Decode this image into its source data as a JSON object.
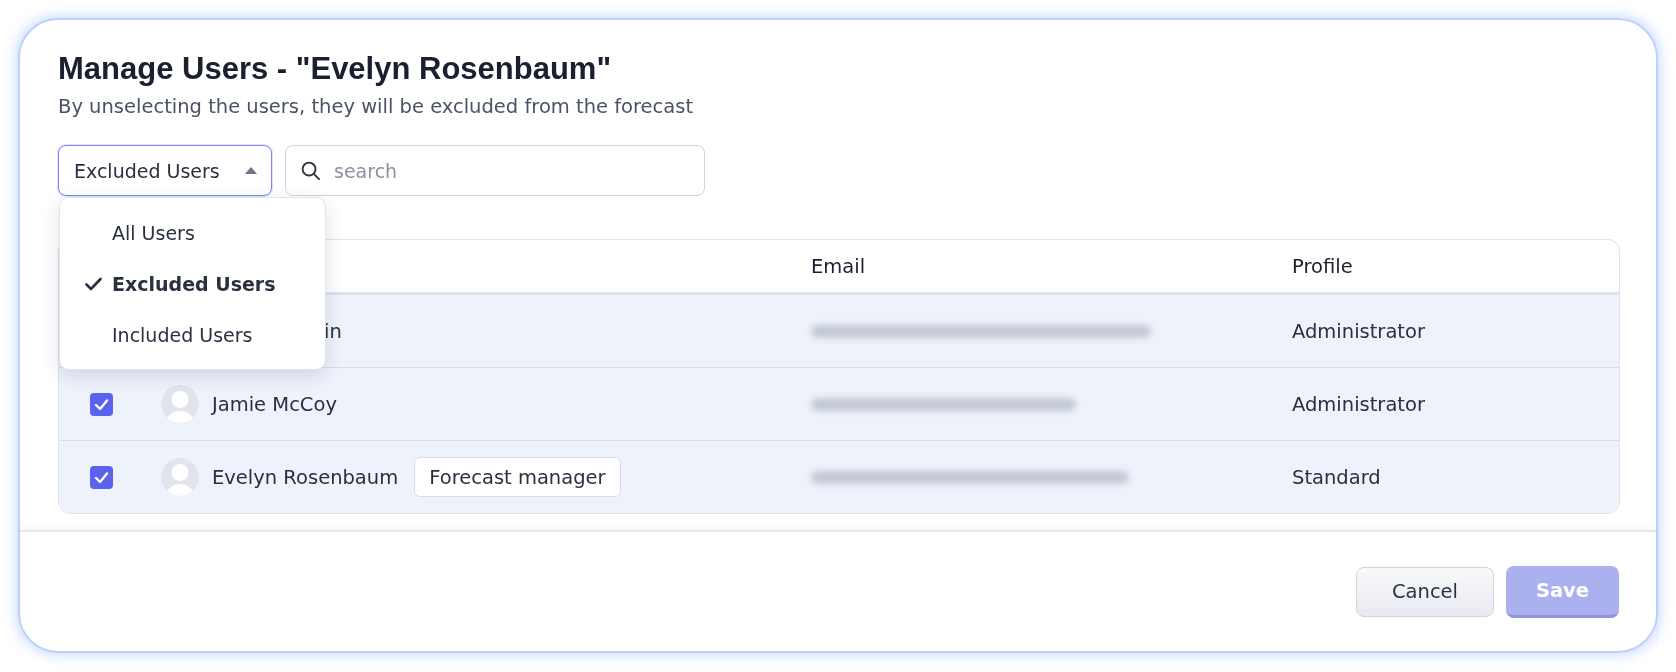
{
  "dialog": {
    "title": "Manage Users - \"Evelyn Rosenbaum\"",
    "subtitle": "By unselecting the users, they will be excluded from the forecast"
  },
  "filter": {
    "value": "Excluded Users",
    "expanded": true,
    "options": [
      {
        "label": "All Users",
        "selected": false
      },
      {
        "label": "Excluded Users",
        "selected": true
      },
      {
        "label": "Included Users",
        "selected": false
      }
    ]
  },
  "search": {
    "placeholder": "search"
  },
  "table": {
    "columns": [
      "Email",
      "Profile"
    ],
    "rows": [
      {
        "kind": "covered",
        "name": "in",
        "email_blurred": true,
        "profile": "Administrator"
      },
      {
        "kind": "user",
        "checked": true,
        "name": "Jamie McCoy",
        "email_blurred": true,
        "profile": "Administrator"
      },
      {
        "kind": "user",
        "checked": true,
        "name": "Evelyn Rosenbaum",
        "badge": "Forecast manager",
        "email_blurred": true,
        "profile": "Standard"
      }
    ]
  },
  "footer": {
    "buttons": [
      {
        "label": "Cancel",
        "kind": "secondary",
        "disabled": false
      },
      {
        "label": "Save",
        "kind": "primary",
        "disabled": true
      }
    ]
  }
}
